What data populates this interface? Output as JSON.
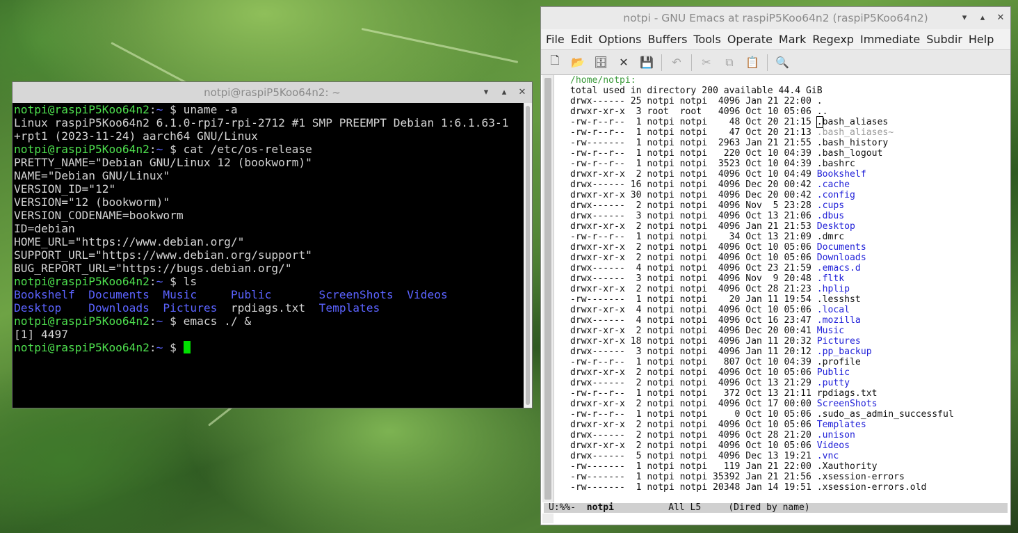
{
  "terminal": {
    "title": "notpi@raspiP5Koo64n2: ~",
    "window_controls": [
      "▾",
      "▴",
      "✕"
    ],
    "lines": [
      [
        {
          "c": "g",
          "t": "notpi@raspiP5Koo64n2"
        },
        {
          "c": "w",
          "t": ":"
        },
        {
          "c": "b",
          "t": "~"
        },
        {
          "c": "w",
          "t": " $ uname -a"
        }
      ],
      [
        {
          "c": "w",
          "t": "Linux raspiP5Koo64n2 6.1.0-rpi7-rpi-2712 #1 SMP PREEMPT Debian 1:6.1.63-1"
        }
      ],
      [
        {
          "c": "w",
          "t": "+rpt1 (2023-11-24) aarch64 GNU/Linux"
        }
      ],
      [
        {
          "c": "g",
          "t": "notpi@raspiP5Koo64n2"
        },
        {
          "c": "w",
          "t": ":"
        },
        {
          "c": "b",
          "t": "~"
        },
        {
          "c": "w",
          "t": " $ cat /etc/os-release"
        }
      ],
      [
        {
          "c": "w",
          "t": "PRETTY_NAME=\"Debian GNU/Linux 12 (bookworm)\""
        }
      ],
      [
        {
          "c": "w",
          "t": "NAME=\"Debian GNU/Linux\""
        }
      ],
      [
        {
          "c": "w",
          "t": "VERSION_ID=\"12\""
        }
      ],
      [
        {
          "c": "w",
          "t": "VERSION=\"12 (bookworm)\""
        }
      ],
      [
        {
          "c": "w",
          "t": "VERSION_CODENAME=bookworm"
        }
      ],
      [
        {
          "c": "w",
          "t": "ID=debian"
        }
      ],
      [
        {
          "c": "w",
          "t": "HOME_URL=\"https://www.debian.org/\""
        }
      ],
      [
        {
          "c": "w",
          "t": "SUPPORT_URL=\"https://www.debian.org/support\""
        }
      ],
      [
        {
          "c": "w",
          "t": "BUG_REPORT_URL=\"https://bugs.debian.org/\""
        }
      ],
      [
        {
          "c": "g",
          "t": "notpi@raspiP5Koo64n2"
        },
        {
          "c": "w",
          "t": ":"
        },
        {
          "c": "b",
          "t": "~"
        },
        {
          "c": "w",
          "t": " $ ls"
        }
      ],
      [
        {
          "c": "b",
          "t": "Bookshelf  Documents  Music     Public       ScreenShots  Videos"
        }
      ],
      [
        {
          "c": "b",
          "t": "Desktop    Downloads  Pictures  "
        },
        {
          "c": "w",
          "t": "rpdiags.txt  "
        },
        {
          "c": "b",
          "t": "Templates"
        }
      ],
      [
        {
          "c": "g",
          "t": "notpi@raspiP5Koo64n2"
        },
        {
          "c": "w",
          "t": ":"
        },
        {
          "c": "b",
          "t": "~"
        },
        {
          "c": "w",
          "t": " $ emacs ./ &"
        }
      ],
      [
        {
          "c": "w",
          "t": "[1] 4497"
        }
      ],
      [
        {
          "c": "g",
          "t": "notpi@raspiP5Koo64n2"
        },
        {
          "c": "w",
          "t": ":"
        },
        {
          "c": "b",
          "t": "~"
        },
        {
          "c": "w",
          "t": " $ "
        },
        {
          "c": "cursor",
          "t": ""
        }
      ]
    ]
  },
  "emacs": {
    "title": "notpi - GNU Emacs at raspiP5Koo64n2 (raspiP5Koo64n2)",
    "window_controls": [
      "▾",
      "▴",
      "✕"
    ],
    "menu": [
      "File",
      "Edit",
      "Options",
      "Buffers",
      "Tools",
      "Operate",
      "Mark",
      "Regexp",
      "Immediate",
      "Subdir",
      "Help"
    ],
    "toolbar": [
      {
        "name": "new-file-icon",
        "glyph": "🗋",
        "enabled": true
      },
      {
        "name": "open-folder-icon",
        "glyph": "📂",
        "enabled": true
      },
      {
        "name": "dired-icon",
        "glyph": "🗄",
        "enabled": true
      },
      {
        "name": "close-buffer-icon",
        "glyph": "✕",
        "enabled": true
      },
      {
        "name": "save-icon",
        "glyph": "💾",
        "enabled": false
      },
      {
        "sep": true
      },
      {
        "name": "undo-icon",
        "glyph": "↶",
        "enabled": false
      },
      {
        "sep": true
      },
      {
        "name": "cut-icon",
        "glyph": "✂",
        "enabled": false
      },
      {
        "name": "copy-icon",
        "glyph": "⧉",
        "enabled": false
      },
      {
        "name": "paste-icon",
        "glyph": "📋",
        "enabled": false
      },
      {
        "sep": true
      },
      {
        "name": "search-icon",
        "glyph": "🔍",
        "enabled": true
      }
    ],
    "dired_header": "/home/notpi:",
    "dired_summary": "total used in directory 200 available 44.4 GiB",
    "entries": [
      {
        "meta": "drwx------ 25 notpi notpi  4096 Jan 21 22:00 ",
        "name": ".",
        "type": "plain"
      },
      {
        "meta": "drwxr-xr-x  3 root  root   4096 Oct 10 05:06 ",
        "name": "..",
        "type": "plain"
      },
      {
        "meta": "-rw-r--r--  1 notpi notpi    48 Oct 20 21:15 ",
        "name": ".bash_aliases",
        "type": "point"
      },
      {
        "meta": "-rw-r--r--  1 notpi notpi    47 Oct 20 21:13 ",
        "name": ".bash_aliases~",
        "type": "bak"
      },
      {
        "meta": "-rw-------  1 notpi notpi  2963 Jan 21 21:55 ",
        "name": ".bash_history",
        "type": "plain"
      },
      {
        "meta": "-rw-r--r--  1 notpi notpi   220 Oct 10 04:39 ",
        "name": ".bash_logout",
        "type": "plain"
      },
      {
        "meta": "-rw-r--r--  1 notpi notpi  3523 Oct 10 04:39 ",
        "name": ".bashrc",
        "type": "plain"
      },
      {
        "meta": "drwxr-xr-x  2 notpi notpi  4096 Oct 10 04:49 ",
        "name": "Bookshelf",
        "type": "dir"
      },
      {
        "meta": "drwx------ 16 notpi notpi  4096 Dec 20 00:42 ",
        "name": ".cache",
        "type": "dir"
      },
      {
        "meta": "drwxr-xr-x 30 notpi notpi  4096 Dec 20 00:42 ",
        "name": ".config",
        "type": "dir"
      },
      {
        "meta": "drwx------  2 notpi notpi  4096 Nov  5 23:28 ",
        "name": ".cups",
        "type": "dir"
      },
      {
        "meta": "drwx------  3 notpi notpi  4096 Oct 13 21:06 ",
        "name": ".dbus",
        "type": "dir"
      },
      {
        "meta": "drwxr-xr-x  2 notpi notpi  4096 Jan 21 21:53 ",
        "name": "Desktop",
        "type": "dir"
      },
      {
        "meta": "-rw-r--r--  1 notpi notpi    34 Oct 13 21:09 ",
        "name": ".dmrc",
        "type": "plain"
      },
      {
        "meta": "drwxr-xr-x  2 notpi notpi  4096 Oct 10 05:06 ",
        "name": "Documents",
        "type": "dir"
      },
      {
        "meta": "drwxr-xr-x  2 notpi notpi  4096 Oct 10 05:06 ",
        "name": "Downloads",
        "type": "dir"
      },
      {
        "meta": "drwx------  4 notpi notpi  4096 Oct 23 21:59 ",
        "name": ".emacs.d",
        "type": "dir"
      },
      {
        "meta": "drwx------  3 notpi notpi  4096 Nov  9 20:48 ",
        "name": ".fltk",
        "type": "dir"
      },
      {
        "meta": "drwxr-xr-x  2 notpi notpi  4096 Oct 28 21:23 ",
        "name": ".hplip",
        "type": "dir"
      },
      {
        "meta": "-rw-------  1 notpi notpi    20 Jan 11 19:54 ",
        "name": ".lesshst",
        "type": "plain"
      },
      {
        "meta": "drwxr-xr-x  4 notpi notpi  4096 Oct 10 05:06 ",
        "name": ".local",
        "type": "dir"
      },
      {
        "meta": "drwx------  4 notpi notpi  4096 Oct 16 23:47 ",
        "name": ".mozilla",
        "type": "dir"
      },
      {
        "meta": "drwxr-xr-x  2 notpi notpi  4096 Dec 20 00:41 ",
        "name": "Music",
        "type": "dir"
      },
      {
        "meta": "drwxr-xr-x 18 notpi notpi  4096 Jan 11 20:32 ",
        "name": "Pictures",
        "type": "dir"
      },
      {
        "meta": "drwx------  3 notpi notpi  4096 Jan 11 20:12 ",
        "name": ".pp_backup",
        "type": "dir"
      },
      {
        "meta": "-rw-r--r--  1 notpi notpi   807 Oct 10 04:39 ",
        "name": ".profile",
        "type": "plain"
      },
      {
        "meta": "drwxr-xr-x  2 notpi notpi  4096 Oct 10 05:06 ",
        "name": "Public",
        "type": "dir"
      },
      {
        "meta": "drwx------  2 notpi notpi  4096 Oct 13 21:29 ",
        "name": ".putty",
        "type": "dir"
      },
      {
        "meta": "-rw-r--r--  1 notpi notpi   372 Oct 13 21:11 ",
        "name": "rpdiags.txt",
        "type": "plain"
      },
      {
        "meta": "drwxr-xr-x  2 notpi notpi  4096 Oct 17 00:00 ",
        "name": "ScreenShots",
        "type": "dir"
      },
      {
        "meta": "-rw-r--r--  1 notpi notpi     0 Oct 10 05:06 ",
        "name": ".sudo_as_admin_successful",
        "type": "plain"
      },
      {
        "meta": "drwxr-xr-x  2 notpi notpi  4096 Oct 10 05:06 ",
        "name": "Templates",
        "type": "dir"
      },
      {
        "meta": "drwx------  2 notpi notpi  4096 Oct 28 21:20 ",
        "name": ".unison",
        "type": "dir"
      },
      {
        "meta": "drwxr-xr-x  2 notpi notpi  4096 Oct 10 05:06 ",
        "name": "Videos",
        "type": "dir"
      },
      {
        "meta": "drwx------  5 notpi notpi  4096 Dec 13 19:21 ",
        "name": ".vnc",
        "type": "dir"
      },
      {
        "meta": "-rw-------  1 notpi notpi   119 Jan 21 22:00 ",
        "name": ".Xauthority",
        "type": "plain"
      },
      {
        "meta": "-rw-------  1 notpi notpi 35392 Jan 21 21:56 ",
        "name": ".xsession-errors",
        "type": "plain"
      },
      {
        "meta": "-rw-------  1 notpi notpi 20348 Jan 14 19:51 ",
        "name": ".xsession-errors.old",
        "type": "plain"
      }
    ],
    "modeline": {
      "status": "U:%%-  ",
      "buffer": "notpi",
      "position": "          All L5     ",
      "mode": "(Dired by name)"
    }
  },
  "colors": {
    "prompt_user": "#4ee04e",
    "prompt_dir": "#5b63ff",
    "dired_dir": "#2020d8",
    "dired_header": "#3a9a3a"
  }
}
